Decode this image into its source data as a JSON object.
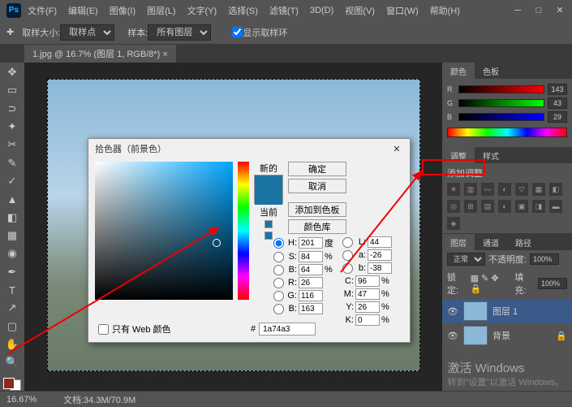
{
  "menu": [
    "文件(F)",
    "编辑(E)",
    "图像(I)",
    "图层(L)",
    "文字(Y)",
    "选择(S)",
    "滤镜(T)",
    "3D(D)",
    "视图(V)",
    "窗口(W)",
    "帮助(H)"
  ],
  "optbar": {
    "sample_size_label": "取样大小:",
    "sample_size_value": "取样点",
    "sample_label": "样本:",
    "sample_value": "所有图层",
    "show_ring": "显示取样环"
  },
  "doc_tab": "1.jpg @ 16.7% (图层 1, RGB/8*) ×",
  "panels": {
    "color_tab": "颜色",
    "swatch_tab": "色板",
    "r": "143",
    "g": "43",
    "b": "29",
    "adj_tab": "调整",
    "style_tab": "样式",
    "adj_label": "添加调整",
    "layers_tab": "图层",
    "channels_tab": "通道",
    "paths_tab": "路径",
    "blend": "正常",
    "opacity_label": "不透明度:",
    "opacity": "100%",
    "lock_label": "锁定:",
    "fill_label": "填充:",
    "fill": "100%",
    "layer1": "图层 1",
    "bg_layer": "背景"
  },
  "status": {
    "zoom": "16.67%",
    "doc": "文档:34.3M/70.9M"
  },
  "picker": {
    "title": "拾色器（前景色）",
    "new_label": "新的",
    "current_label": "当前",
    "ok": "确定",
    "cancel": "取消",
    "add": "添加到色板",
    "lib": "颜色库",
    "webonly": "只有 Web 颜色",
    "h": "201",
    "s": "84",
    "b_pct": "64",
    "r": "26",
    "g": "116",
    "b": "163",
    "l": "44",
    "a": "-26",
    "b_lab": "-38",
    "c": "96",
    "m": "47",
    "y": "26",
    "k": "0",
    "h_unit": "度",
    "pct": "%",
    "hex": "1a74a3"
  },
  "watermark": {
    "line1": "激活 Windows",
    "line2": "转到\"设置\"以激活 Windows。"
  }
}
